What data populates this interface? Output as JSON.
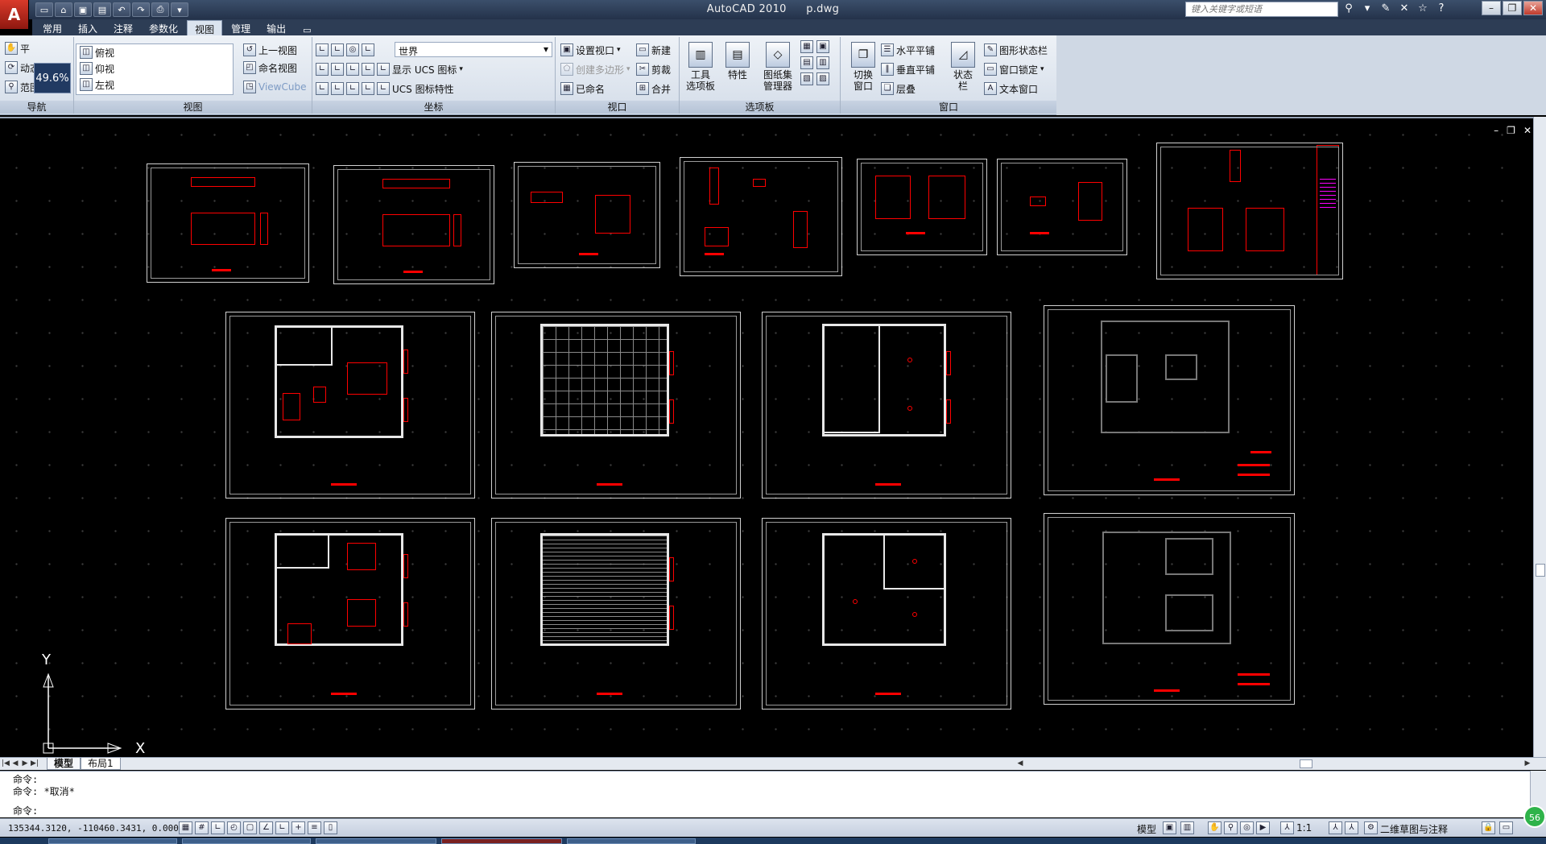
{
  "window": {
    "title_app": "AutoCAD 2010",
    "title_file": "p.dwg",
    "search_placeholder": "键入关键字或短语"
  },
  "tabs": [
    {
      "label": "常用"
    },
    {
      "label": "插入"
    },
    {
      "label": "注释"
    },
    {
      "label": "参数化"
    },
    {
      "label": "视图",
      "active": true
    },
    {
      "label": "管理"
    },
    {
      "label": "输出"
    }
  ],
  "ribbon": {
    "navigate": {
      "title": "导航",
      "pan": "平",
      "orbit": "动态",
      "extents": "范围",
      "zoom_value": "49.6%"
    },
    "views": {
      "title": "视图",
      "list": [
        "俯视",
        "仰视",
        "左视"
      ],
      "prev_view": "上一视图",
      "named_views": "命名视图",
      "viewcube": "ViewCube"
    },
    "coordinates": {
      "title": "坐标",
      "ucs_world": "世界",
      "show_ucs_icon": "显示 UCS 图标",
      "ucs_icon_props": "UCS 图标特性"
    },
    "viewports": {
      "title": "视口",
      "set_viewport": "设置视口",
      "poly_viewport": "创建多边形",
      "named": "已命名",
      "new": "新建",
      "clip": "剪裁",
      "join": "合并"
    },
    "palettes": {
      "title": "选项板",
      "tool_palettes_l1": "工具",
      "tool_palettes_l2": "选项板",
      "properties": "特性",
      "sheet_set_l1": "图纸集",
      "sheet_set_l2": "管理器"
    },
    "window": {
      "title": "窗口",
      "switch_l1": "切换",
      "switch_l2": "窗口",
      "tile_horizontal": "水平平铺",
      "tile_vertical": "垂直平铺",
      "cascade": "层叠",
      "status_l1": "状态",
      "status_l2": "栏",
      "layout_bar": "图形状态栏",
      "window_lock": "窗口锁定",
      "text_window": "文本窗口"
    }
  },
  "layout_tabs": [
    {
      "label": "模型",
      "active": true
    },
    {
      "label": "布局1"
    }
  ],
  "command": {
    "line1": "命令:",
    "line2": "命令: *取消*",
    "prompt": "命令:"
  },
  "status": {
    "coords": "135344.3120, -110460.3431, 0.0000",
    "model": "模型",
    "scale": "1:1",
    "workspace": "二维草图与注释",
    "badge": "56"
  },
  "ucs_labels": {
    "y": "Y",
    "x": "X"
  },
  "icons": {
    "app_menu": "autocad-logo",
    "search": "binoculars-icon",
    "tools": "wrench-icon",
    "star": "star-icon",
    "help": "help-icon"
  }
}
